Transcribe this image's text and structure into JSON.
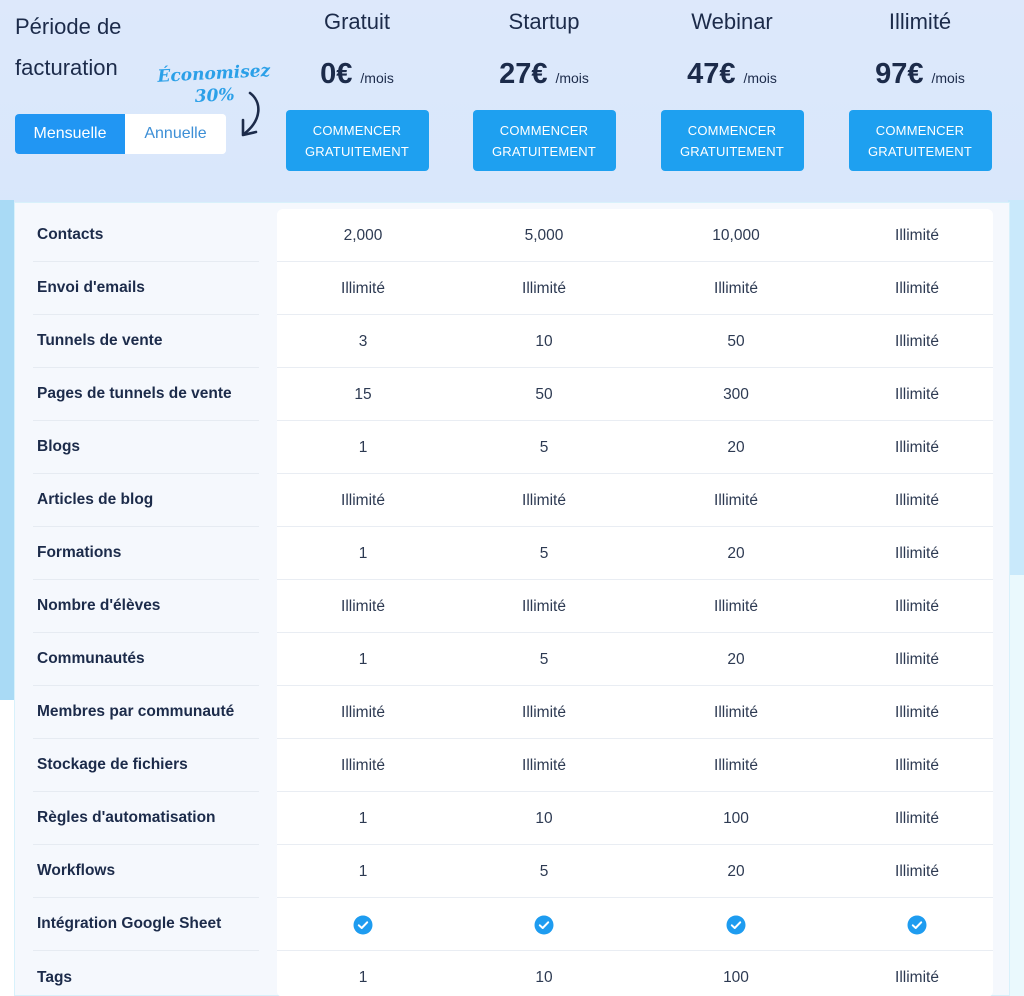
{
  "billing": {
    "title_line1": "Période de",
    "title_line2": "facturation",
    "save_note_line1": "Économisez",
    "save_note_line2": "30%",
    "options": [
      {
        "label": "Mensuelle",
        "active": true
      },
      {
        "label": "Annuelle",
        "active": false
      }
    ]
  },
  "plans": [
    {
      "name": "Gratuit",
      "price": "0€",
      "unit": "/mois",
      "cta_line1": "COMMENCER",
      "cta_line2": "GRATUITEMENT"
    },
    {
      "name": "Startup",
      "price": "27€",
      "unit": "/mois",
      "cta_line1": "COMMENCER",
      "cta_line2": "GRATUITEMENT"
    },
    {
      "name": "Webinar",
      "price": "47€",
      "unit": "/mois",
      "cta_line1": "COMMENCER",
      "cta_line2": "GRATUITEMENT"
    },
    {
      "name": "Illimité",
      "price": "97€",
      "unit": "/mois",
      "cta_line1": "COMMENCER",
      "cta_line2": "GRATUITEMENT"
    }
  ],
  "features": [
    {
      "label": "Contacts",
      "values": [
        "2,000",
        "5,000",
        "10,000",
        "Illimité"
      ]
    },
    {
      "label": "Envoi d'emails",
      "values": [
        "Illimité",
        "Illimité",
        "Illimité",
        "Illimité"
      ]
    },
    {
      "label": "Tunnels de vente",
      "values": [
        "3",
        "10",
        "50",
        "Illimité"
      ]
    },
    {
      "label": "Pages de tunnels de vente",
      "values": [
        "15",
        "50",
        "300",
        "Illimité"
      ]
    },
    {
      "label": "Blogs",
      "values": [
        "1",
        "5",
        "20",
        "Illimité"
      ]
    },
    {
      "label": "Articles de blog",
      "values": [
        "Illimité",
        "Illimité",
        "Illimité",
        "Illimité"
      ]
    },
    {
      "label": "Formations",
      "values": [
        "1",
        "5",
        "20",
        "Illimité"
      ]
    },
    {
      "label": "Nombre d'élèves",
      "values": [
        "Illimité",
        "Illimité",
        "Illimité",
        "Illimité"
      ]
    },
    {
      "label": "Communautés",
      "values": [
        "1",
        "5",
        "20",
        "Illimité"
      ]
    },
    {
      "label": "Membres par communauté",
      "values": [
        "Illimité",
        "Illimité",
        "Illimité",
        "Illimité"
      ]
    },
    {
      "label": "Stockage de fichiers",
      "values": [
        "Illimité",
        "Illimité",
        "Illimité",
        "Illimité"
      ]
    },
    {
      "label": "Règles d'automatisation",
      "values": [
        "1",
        "10",
        "100",
        "Illimité"
      ]
    },
    {
      "label": "Workflows",
      "values": [
        "1",
        "5",
        "20",
        "Illimité"
      ]
    },
    {
      "label": "Intégration Google Sheet",
      "values": [
        "check-icon",
        "check-icon",
        "check-icon",
        "check-icon"
      ]
    },
    {
      "label": "Tags",
      "values": [
        "1",
        "10",
        "100",
        "Illimité"
      ]
    }
  ],
  "colors": {
    "accent": "#1ea0f0",
    "text_dark": "#1c2b4a",
    "check": "#1e9cf0"
  }
}
